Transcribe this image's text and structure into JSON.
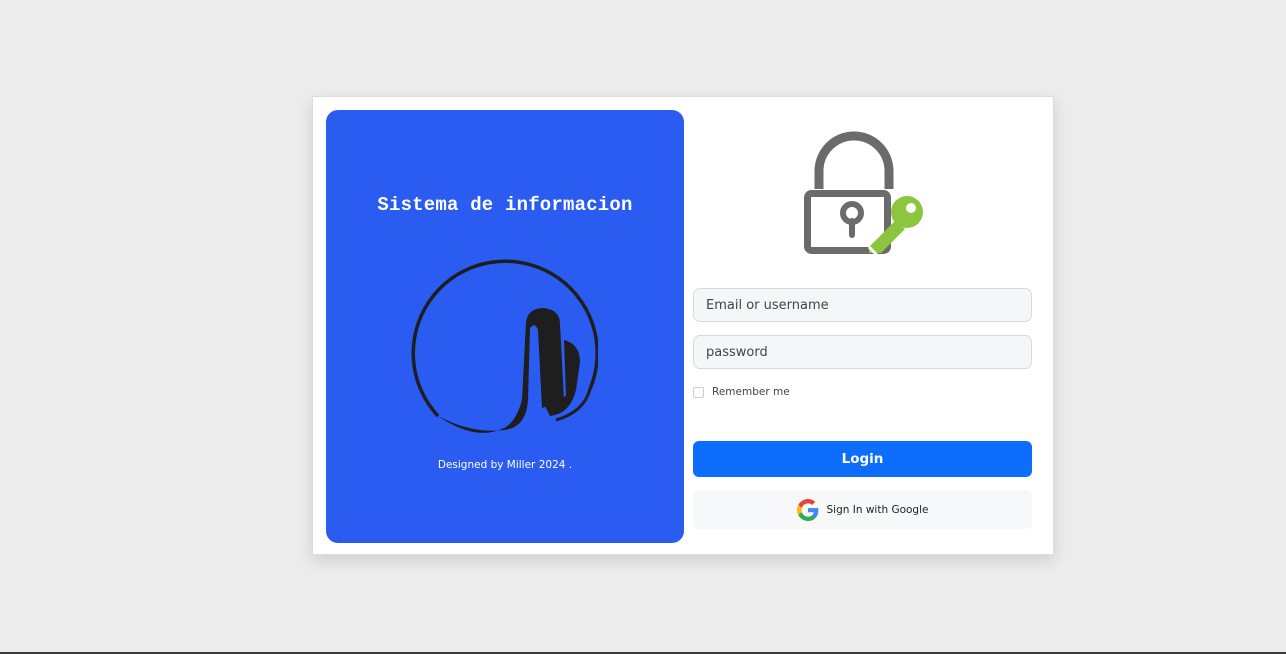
{
  "left_panel": {
    "title": "Sistema de informacion",
    "footer": "Designed by Miller 2024 ."
  },
  "form": {
    "email_placeholder": "Email or username",
    "password_placeholder": "password",
    "remember_label": "Remember me",
    "login_label": "Login",
    "google_label": "Sign In with Google"
  },
  "icons": {
    "brand": "brand-logo-icon",
    "lock": "lock-key-icon",
    "google": "google-icon"
  },
  "colors": {
    "panel_blue": "#2a5cf1",
    "login_blue": "#0d6efd",
    "lock_gray": "#6b6b6b",
    "key_green": "#8cc63f",
    "background": "#ececec"
  }
}
